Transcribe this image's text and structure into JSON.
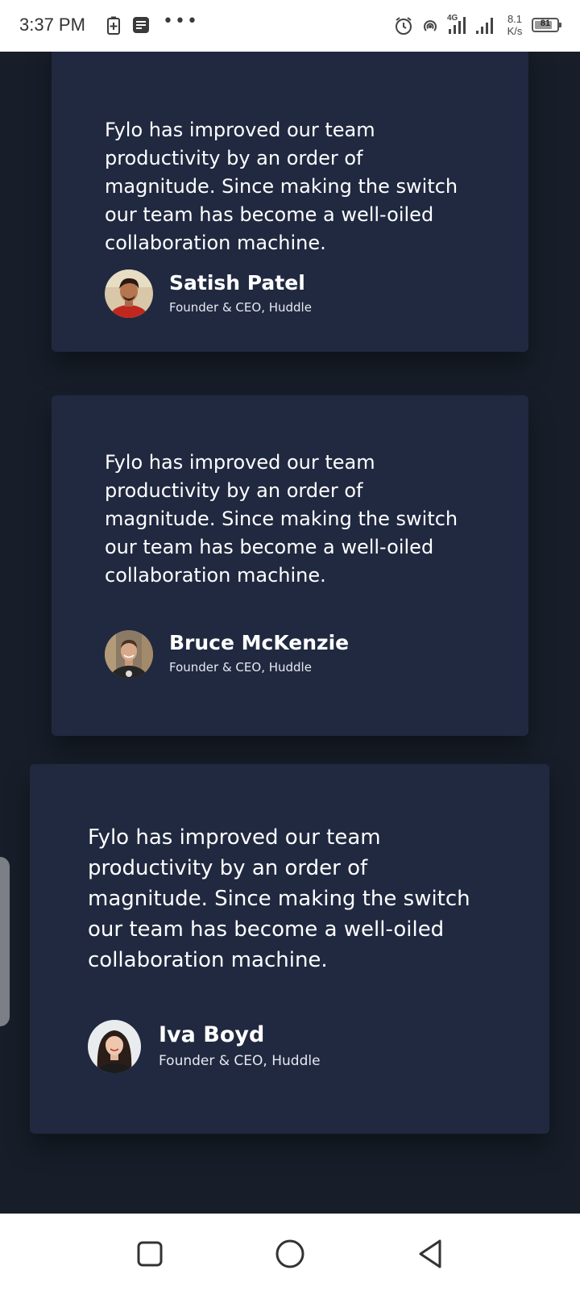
{
  "status_bar": {
    "time": "3:37 PM",
    "more_indicator": "•••",
    "network_type": "4G",
    "speed_value": "8.1",
    "speed_unit": "K/s",
    "battery_level": "81",
    "icons": [
      "battery-saver-icon",
      "notes-icon",
      "alarm-icon",
      "hotspot-icon",
      "signal-4g-icon",
      "signal-icon",
      "battery-icon"
    ]
  },
  "testimonials": [
    {
      "quote": "Fylo has improved our team productivity by an order of magnitude. Since making the switch our team has become a well-oiled collaboration machine.",
      "name": "Satish Patel",
      "role": "Founder & CEO, Huddle"
    },
    {
      "quote": "Fylo has improved our team productivity by an order of magnitude. Since making the switch our team has become a well-oiled collaboration machine.",
      "name": "Bruce McKenzie",
      "role": "Founder & CEO, Huddle"
    },
    {
      "quote": "Fylo has improved our team productivity by an order of magnitude. Since making the switch our team has become a well-oiled collaboration machine.",
      "name": "Iva Boyd",
      "role": "Founder & CEO, Huddle"
    }
  ],
  "nav_bar": {
    "buttons": [
      "recents-square-icon",
      "home-circle-icon",
      "back-triangle-icon"
    ]
  },
  "colors": {
    "page_background": "#171e29",
    "card_background": "#202940",
    "text": "#ffffff",
    "system_bars": "#ffffff"
  }
}
